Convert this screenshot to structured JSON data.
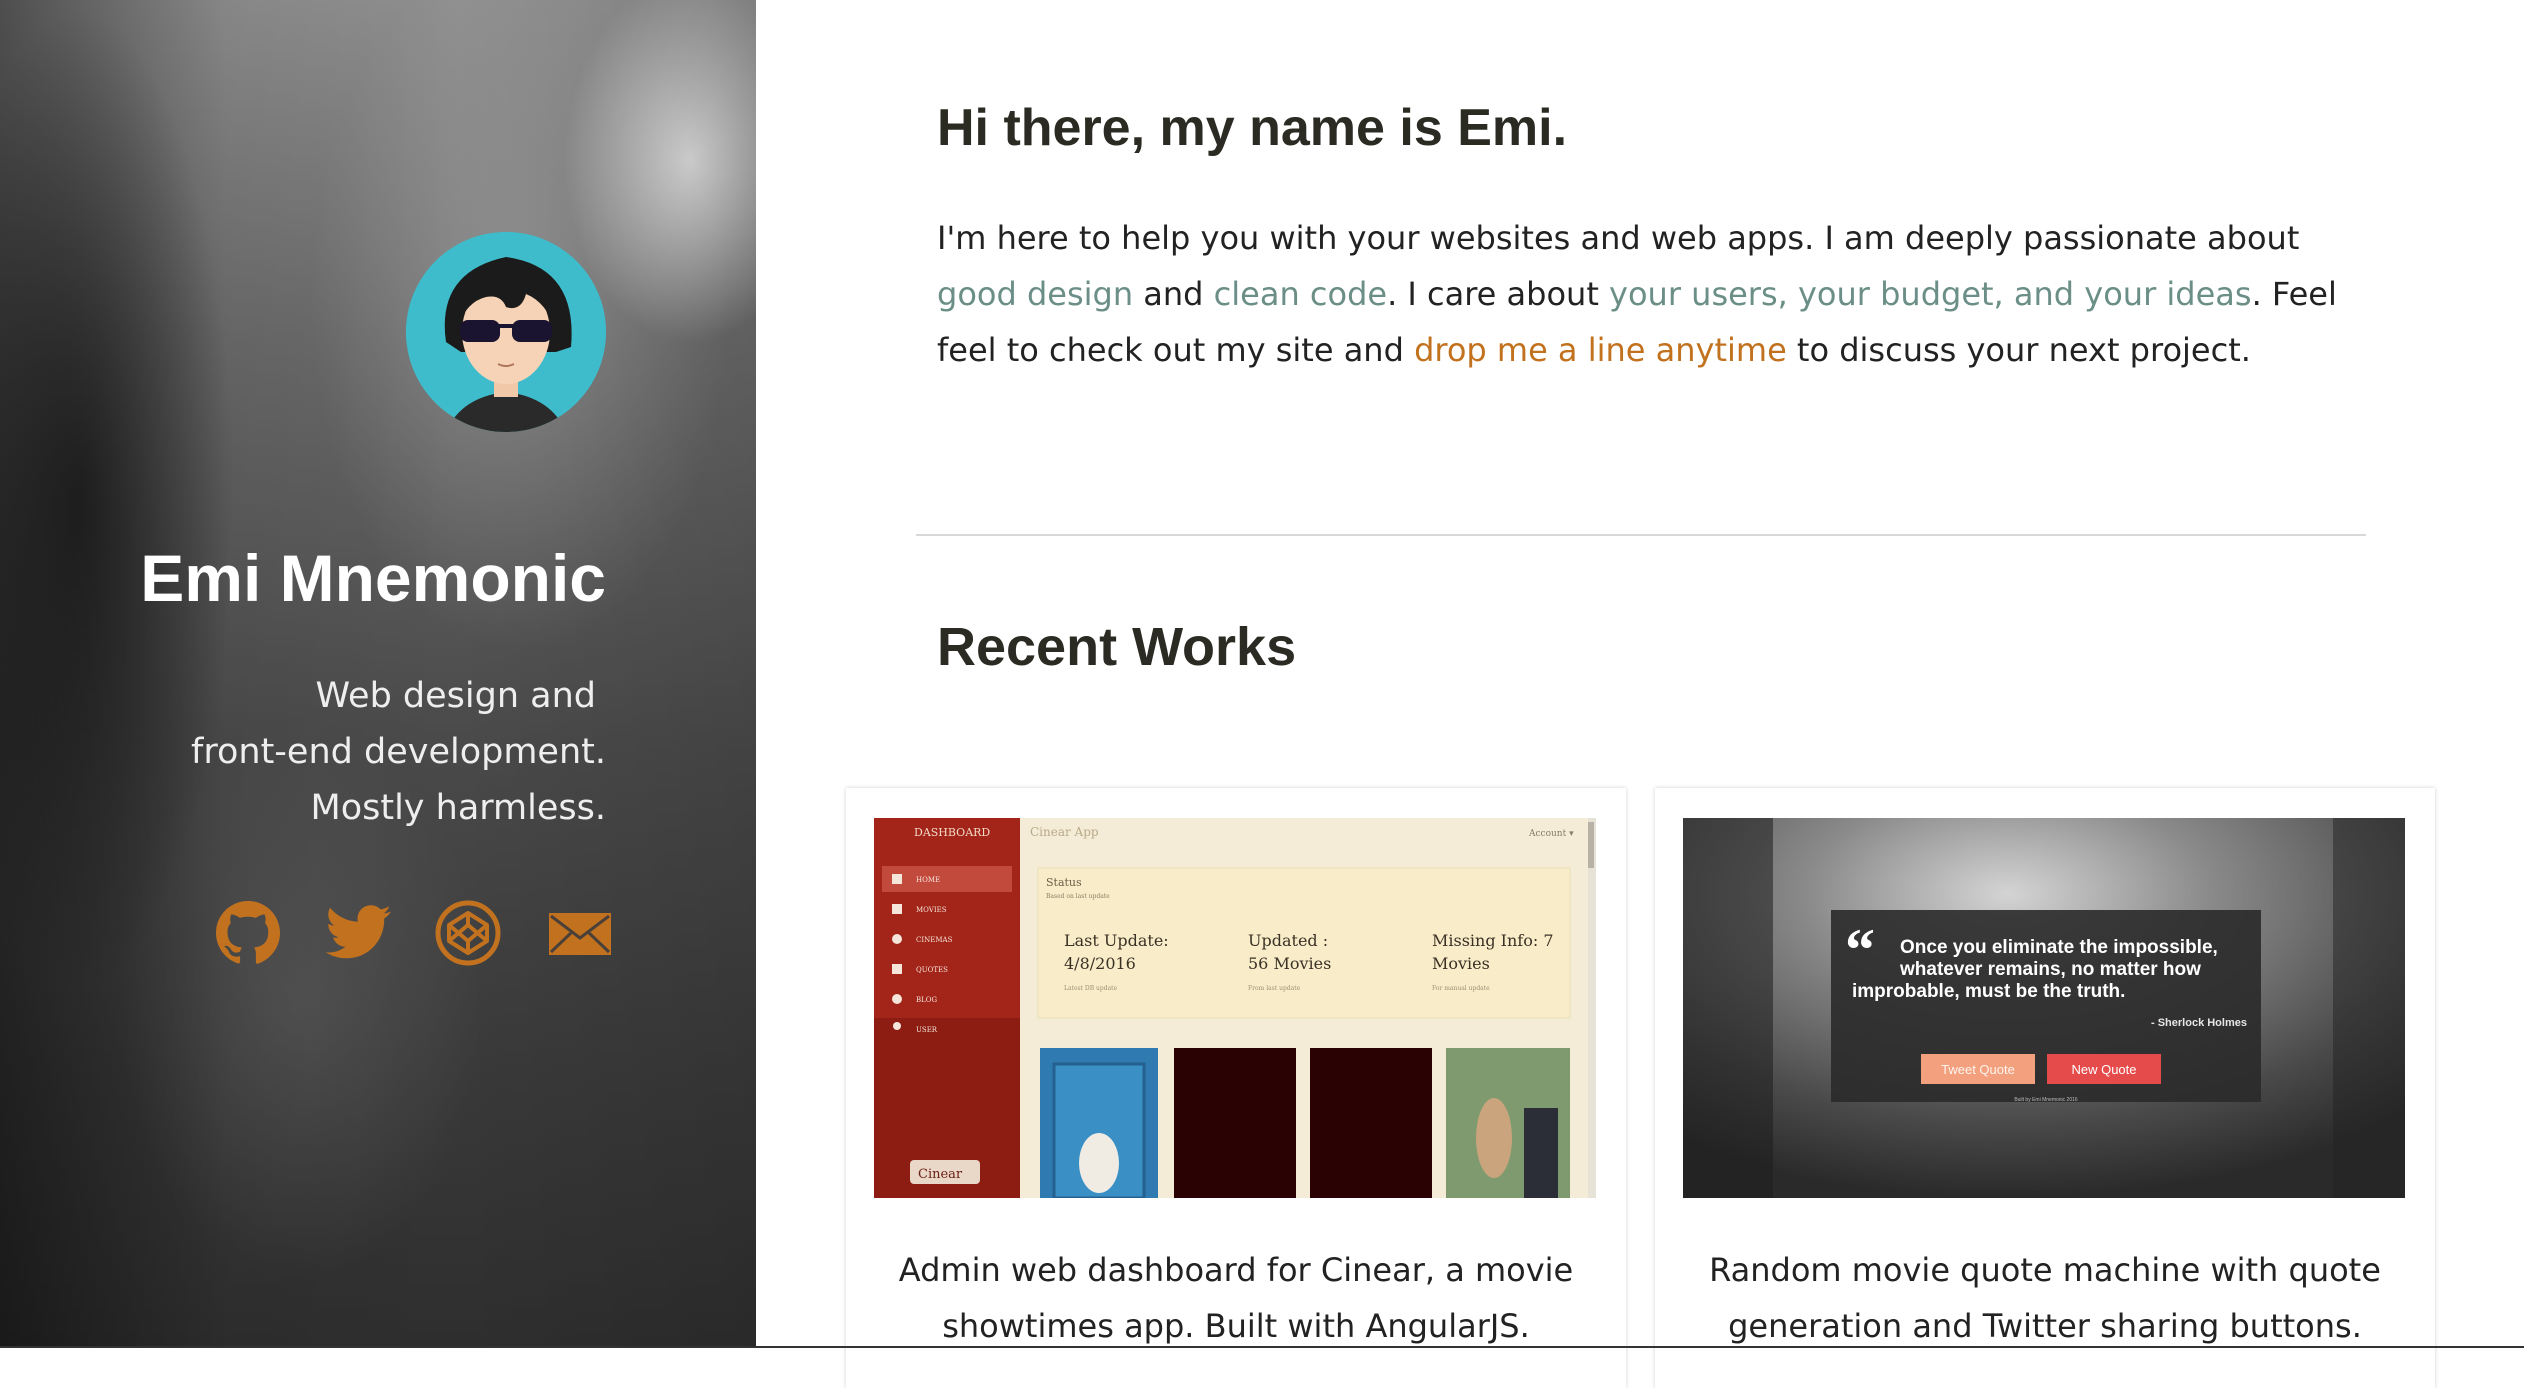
{
  "profile": {
    "name": "Emi Mnemonic",
    "tagline": [
      "Web design and",
      "front-end development.",
      "Mostly harmless."
    ],
    "social": [
      {
        "name": "github-icon",
        "label": "GitHub"
      },
      {
        "name": "twitter-icon",
        "label": "Twitter"
      },
      {
        "name": "codepen-icon",
        "label": "CodePen"
      },
      {
        "name": "mail-icon",
        "label": "Email"
      }
    ]
  },
  "intro": {
    "heading": "Hi there, my name is Emi.",
    "p1": "I'm here to help you with your websites and web apps. I am deeply passionate about ",
    "link_design": "good design",
    "p2": " and ",
    "link_code": "clean code",
    "p3": ". I care about ",
    "link_users": "your users, your budget, and your ideas",
    "p4": ". Feel feel to check out my site and ",
    "link_contact": "drop me a line anytime",
    "p5": " to discuss your next project."
  },
  "works": {
    "heading": "Recent Works",
    "items": [
      {
        "description": "Admin web dashboard for Cinear, a movie showtimes app. Built with AngularJS.",
        "thumb": {
          "sidebar_title": "DASHBOARD",
          "app_title": "Cinear App",
          "account": "Account ▾",
          "menu": [
            "HOME",
            "MOVIES",
            "CINEMAS",
            "QUOTES",
            "BLOG",
            "USER"
          ],
          "status_title": "Status",
          "status_sub": "Based on last update",
          "stats": [
            {
              "label": "Last Update:",
              "value": "4/8/2016",
              "note": "Latest DB update"
            },
            {
              "label": "Updated :",
              "value": "56 Movies",
              "note": "From last update"
            },
            {
              "label": "Missing Info: 7",
              "value": "Movies",
              "note": "For manual update"
            }
          ],
          "logo": "Cinear"
        }
      },
      {
        "description": "Random movie quote machine with quote generation and Twitter sharing buttons.",
        "thumb": {
          "quote": "Once you eliminate the impossible, whatever remains, no matter how improbable, must be the truth.",
          "author": "- Sherlock Holmes",
          "tweet_btn": "Tweet Quote",
          "new_btn": "New Quote",
          "credit": "Built by Emi Mnemonic 2016"
        }
      }
    ]
  },
  "colors": {
    "accent_orange": "#c2721f",
    "link_green": "#6b8f86",
    "heading": "#2b2b24",
    "avatar_bg": "#3fbccb"
  }
}
